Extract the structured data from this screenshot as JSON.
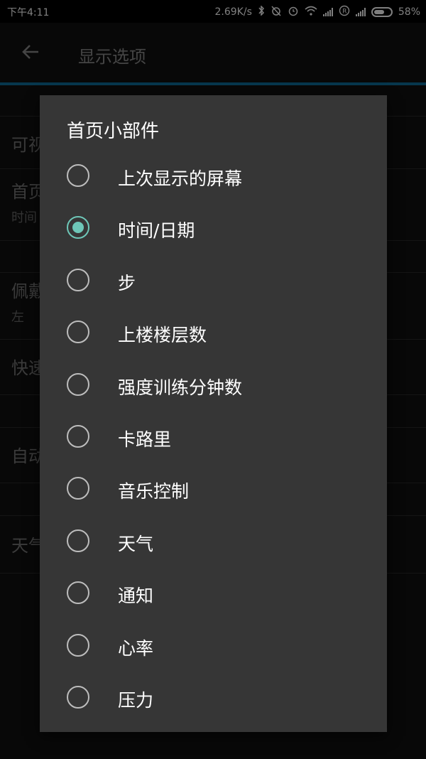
{
  "status_bar": {
    "time": "下午4:11",
    "net_speed": "2.69K/s",
    "battery": "58%",
    "icons": [
      "bluetooth-icon",
      "alarm-off-icon",
      "alarm-clock-icon",
      "wifi-icon",
      "signal-icon",
      "r-icon",
      "signal-icon",
      "battery-icon"
    ]
  },
  "app_bar": {
    "title": "显示选项",
    "back_icon": "arrow-left-icon"
  },
  "background_list": {
    "items": [
      {
        "title": "可视",
        "subtitle": ""
      },
      {
        "title": "首页",
        "subtitle": "时间"
      },
      {
        "title": "佩戴",
        "subtitle": "左"
      },
      {
        "title": "快速",
        "subtitle": ""
      },
      {
        "title": "自动",
        "subtitle": ""
      },
      {
        "title": "天气",
        "subtitle": ""
      }
    ]
  },
  "dialog": {
    "title": "首页小部件",
    "selected_index": 1,
    "accent_color": "#6ec7b8",
    "options": [
      {
        "label": "上次显示的屏幕",
        "checked": false
      },
      {
        "label": "时间/日期",
        "checked": true
      },
      {
        "label": "步",
        "checked": false
      },
      {
        "label": "上楼楼层数",
        "checked": false
      },
      {
        "label": "强度训练分钟数",
        "checked": false
      },
      {
        "label": "卡路里",
        "checked": false
      },
      {
        "label": "音乐控制",
        "checked": false
      },
      {
        "label": "天气",
        "checked": false
      },
      {
        "label": "通知",
        "checked": false
      },
      {
        "label": "心率",
        "checked": false
      },
      {
        "label": "压力",
        "checked": false
      }
    ]
  }
}
